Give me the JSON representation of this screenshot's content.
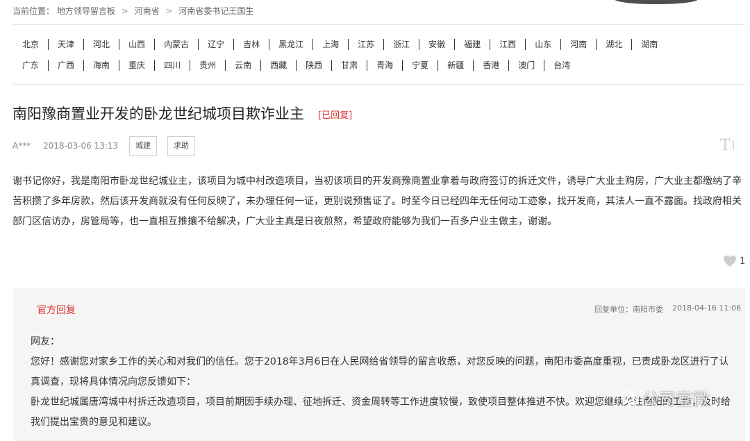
{
  "breadcrumb": {
    "prefix": "当前位置：",
    "items": [
      "地方领导留言板",
      "河南省",
      "河南省委书记王国生"
    ],
    "separator": ">"
  },
  "provinces_row1": [
    "北京",
    "天津",
    "河北",
    "山西",
    "内蒙古",
    "辽宁",
    "吉林",
    "黑龙江",
    "上海",
    "江苏",
    "浙江",
    "安徽",
    "福建",
    "江西",
    "山东",
    "河南",
    "湖北",
    "湖南"
  ],
  "provinces_row2": [
    "广东",
    "广西",
    "海南",
    "重庆",
    "四川",
    "贵州",
    "云南",
    "西藏",
    "陕西",
    "甘肃",
    "青海",
    "宁夏",
    "新疆",
    "香港",
    "澳门",
    "台湾"
  ],
  "post": {
    "title": "南阳豫商置业开发的卧龙世纪城项目欺诈业主",
    "status": "[已回复]",
    "user": "A***",
    "time": "2018-03-06 13:13",
    "tags": [
      "城建",
      "求助"
    ],
    "font_toggle": "T",
    "body": "谢书记你好，我是南阳市卧龙世纪城业主，该项目为城中村改造项目，当初该项目的开发商豫商置业拿着与政府签订的拆迁文件，诱导广大业主购房，广大业主都缴纳了辛苦积攒了多年房款，然后该开发商就没有任何反映了，未办理任何一证，更别说预售证了。时至今日已经四年无任何动工迹象，找开发商，其法人一直不露面。找政府相关部门区信访办，房管局等，也一直相互推攘不给解决，广大业主真是日夜煎熬，希望政府能够为我们一百多户业主做主，谢谢。",
    "likes": "1"
  },
  "reply": {
    "label": "官方回复",
    "unit": "回复单位：南阳市委",
    "time": "2018-04-16 11:06",
    "greeting": "网友：",
    "para1": "您好！感谢您对家乡工作的关心和对我们的信任。您于2018年3月6日在人民网给省领导的留言收悉，对您反映的问题，南阳市委高度重视，已责成卧龙区进行了认真调查，现将具体情况向您反馈如下：",
    "para2": "卧龙世纪城属唐湾城中村拆迁改造项目，项目前期因手续办理、征地拆迁、资金周转等工作进度较慢，致使项目整体推进不快。欢迎您继续关注南阳的工作，及时给我们提出宝贵的意见和建议。"
  },
  "watermark": "公司宣微",
  "colors": {
    "accent_red": "#dd3333",
    "reply_bg": "#f5f5f5",
    "divider": "#e5e5e5"
  },
  "icons": {
    "like": "heart-icon",
    "font_size": "font-size-icon"
  }
}
